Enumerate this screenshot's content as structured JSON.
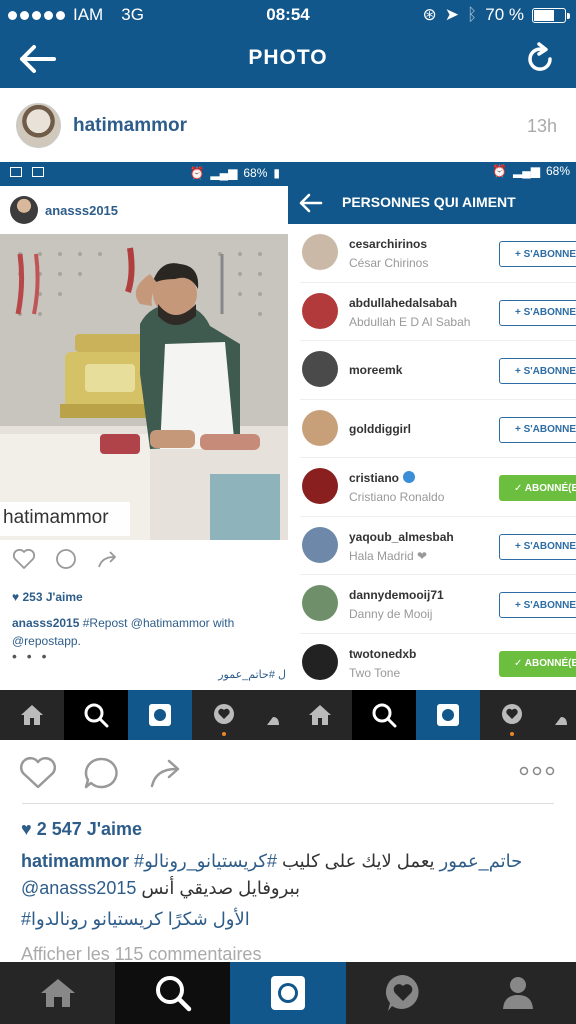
{
  "status_bar": {
    "carrier": "IAM",
    "network": "3G",
    "time": "08:54",
    "battery": "70 %",
    "battery_level": 0.7
  },
  "nav": {
    "title": "PHOTO"
  },
  "post": {
    "username": "hatimammor",
    "time_ago": "13h"
  },
  "embedded_left": {
    "status_battery": "68%",
    "username": "anasss2015",
    "watermark": "hatimammor",
    "likes": "253 J'aime",
    "caption_user": "anasss2015",
    "caption_text": "#Repost @hatimammor with @repostapp.",
    "more": "• • •",
    "arabic_fragment": "ل #حاتم_عمور"
  },
  "embedded_right": {
    "status_battery": "68%",
    "title": "PERSONNES QUI AIMENT",
    "likers": [
      {
        "username": "cesarchirinos",
        "full_name": "César Chirinos",
        "button": "+ S'ABONNER",
        "following": false,
        "avatar_color": "#c9b9a6"
      },
      {
        "username": "abdullahedalsabah",
        "full_name": "Abdullah E D Al Sabah",
        "button": "+ S'ABONNER",
        "following": false,
        "avatar_color": "#b23a3a"
      },
      {
        "username": "moreemk",
        "full_name": "",
        "button": "+ S'ABONNER",
        "following": false,
        "avatar_color": "#4a4a4a"
      },
      {
        "username": "golddiggirl",
        "full_name": "",
        "button": "+ S'ABONNER",
        "following": false,
        "avatar_color": "#c7a07a"
      },
      {
        "username": "cristiano",
        "full_name": "Cristiano Ronaldo",
        "button": "✓ ABONNÉ(E)",
        "following": true,
        "verified": true,
        "avatar_color": "#8a1f1f"
      },
      {
        "username": "yaqoub_almesbah",
        "full_name": "Hala Madrid ❤",
        "button": "+ S'ABONNER",
        "following": false,
        "avatar_color": "#6d88a8"
      },
      {
        "username": "dannydemooij71",
        "full_name": "Danny de Mooij",
        "button": "+ S'ABONNER",
        "following": false,
        "avatar_color": "#6f8f6a"
      },
      {
        "username": "twotonedxb",
        "full_name": "Two Tone",
        "button": "✓ ABONNÉ(E)",
        "following": true,
        "avatar_color": "#222222"
      }
    ]
  },
  "likes": "2 547 J'aime",
  "caption": {
    "username": "hatimammor",
    "hashtags": "#حاتم_عمور",
    "text1": "يعمل لايك على كليب",
    "hashtag2": "#كريستيانو_رونالو",
    "mention": "@anasss2015",
    "text2": "ببروفايل صديقي أنس",
    "line2": "#الأول شكرًا كريستيانو رونالدوا"
  },
  "comments_link": "Afficher les 115 commentaires",
  "icons": {
    "back": "back-arrow-icon",
    "refresh": "refresh-icon",
    "like": "heart-icon",
    "comment": "comment-icon",
    "share": "share-icon",
    "options": "more-options-icon",
    "home": "home-icon",
    "search": "search-icon",
    "camera": "camera-icon",
    "activity": "activity-icon",
    "profile": "profile-icon"
  },
  "colors": {
    "brand": "#12578b",
    "link": "#2e5d8a",
    "follow_green": "#6cbf3e"
  }
}
